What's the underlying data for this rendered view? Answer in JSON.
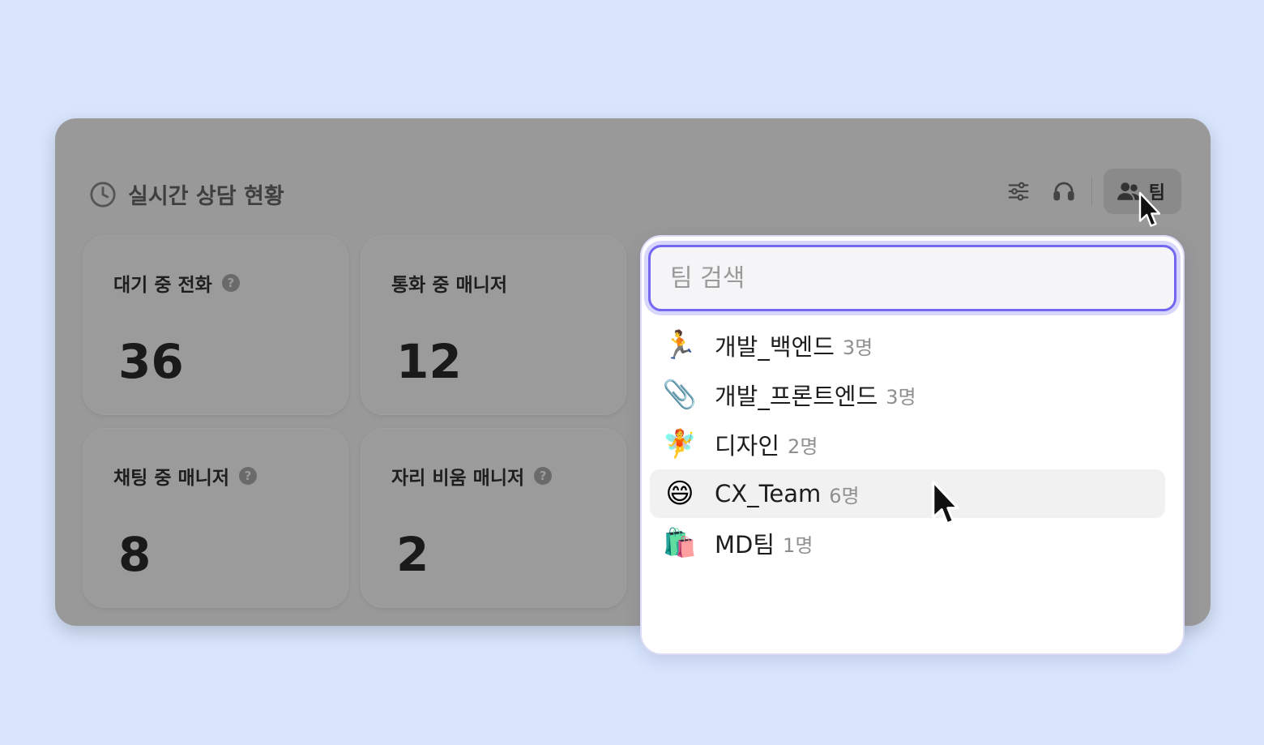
{
  "panel": {
    "title": "실시간 상담 현황",
    "title_icon": "clock-icon",
    "toolbar": {
      "filter_icon": "sliders-icon",
      "headset_icon": "headset-icon",
      "team_button_label": "팀",
      "team_button_icon": "users-icon"
    }
  },
  "cards": [
    {
      "label": "대기 중 전화",
      "value": "36",
      "help": "?"
    },
    {
      "label": "통화 중 매니저",
      "value": "12"
    },
    {
      "label": "채팅 중 매니저",
      "value": "8",
      "help": "?"
    },
    {
      "label": "자리 비움 매니저",
      "value": "2",
      "help": "?"
    }
  ],
  "dropdown": {
    "search_placeholder": "팀 검색",
    "teams": [
      {
        "emoji": "🏃",
        "name": "개발_백엔드",
        "count": "3명"
      },
      {
        "emoji": "📎",
        "name": "개발_프론트엔드",
        "count": "3명"
      },
      {
        "emoji": "🧚",
        "name": "디자인",
        "count": "2명"
      },
      {
        "emoji": "😄",
        "name": "CX_Team",
        "count": "6명"
      },
      {
        "emoji": "🛍️",
        "name": "MD팀",
        "count": "1명"
      }
    ],
    "hovered_team": "CX_Team"
  },
  "colors": {
    "background": "#d8e5fc",
    "accent": "#7367f0"
  }
}
